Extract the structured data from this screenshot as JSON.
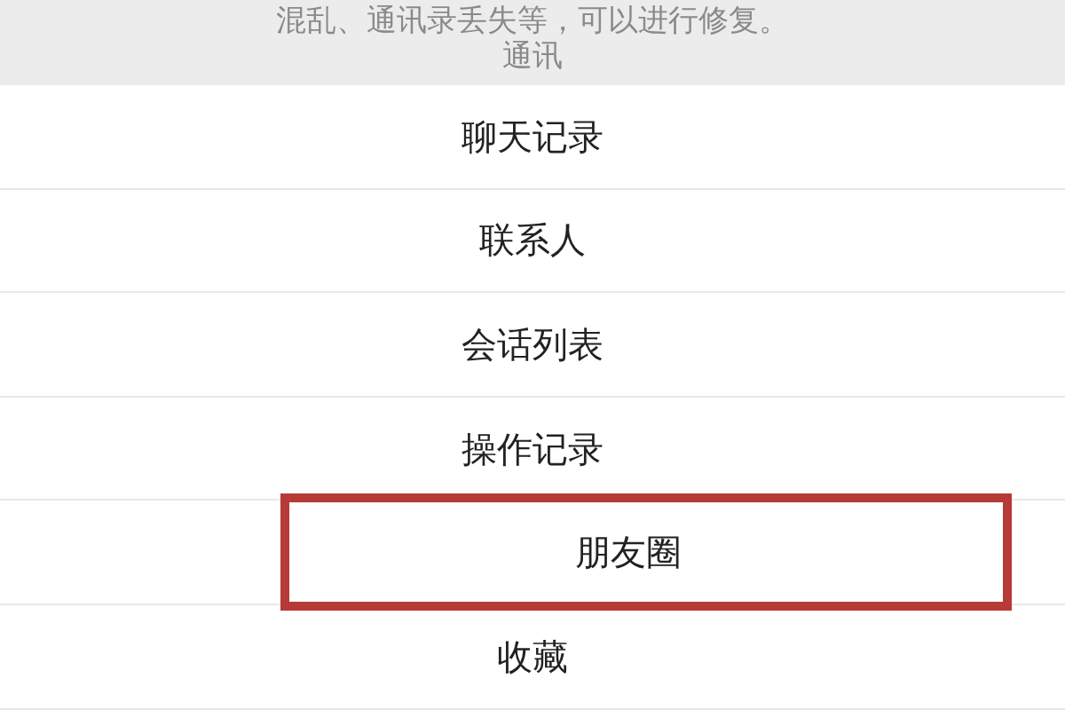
{
  "notice": {
    "lines": [
      "混乱、通讯录丢失等，可以进行修复。",
      "通讯"
    ]
  },
  "options": [
    {
      "label": "聊天记录",
      "highlighted": false
    },
    {
      "label": "联系人",
      "highlighted": false
    },
    {
      "label": "会话列表",
      "highlighted": false
    },
    {
      "label": "操作记录",
      "highlighted": false
    },
    {
      "label": "朋友圈",
      "highlighted": true
    },
    {
      "label": "收藏",
      "highlighted": false
    }
  ]
}
